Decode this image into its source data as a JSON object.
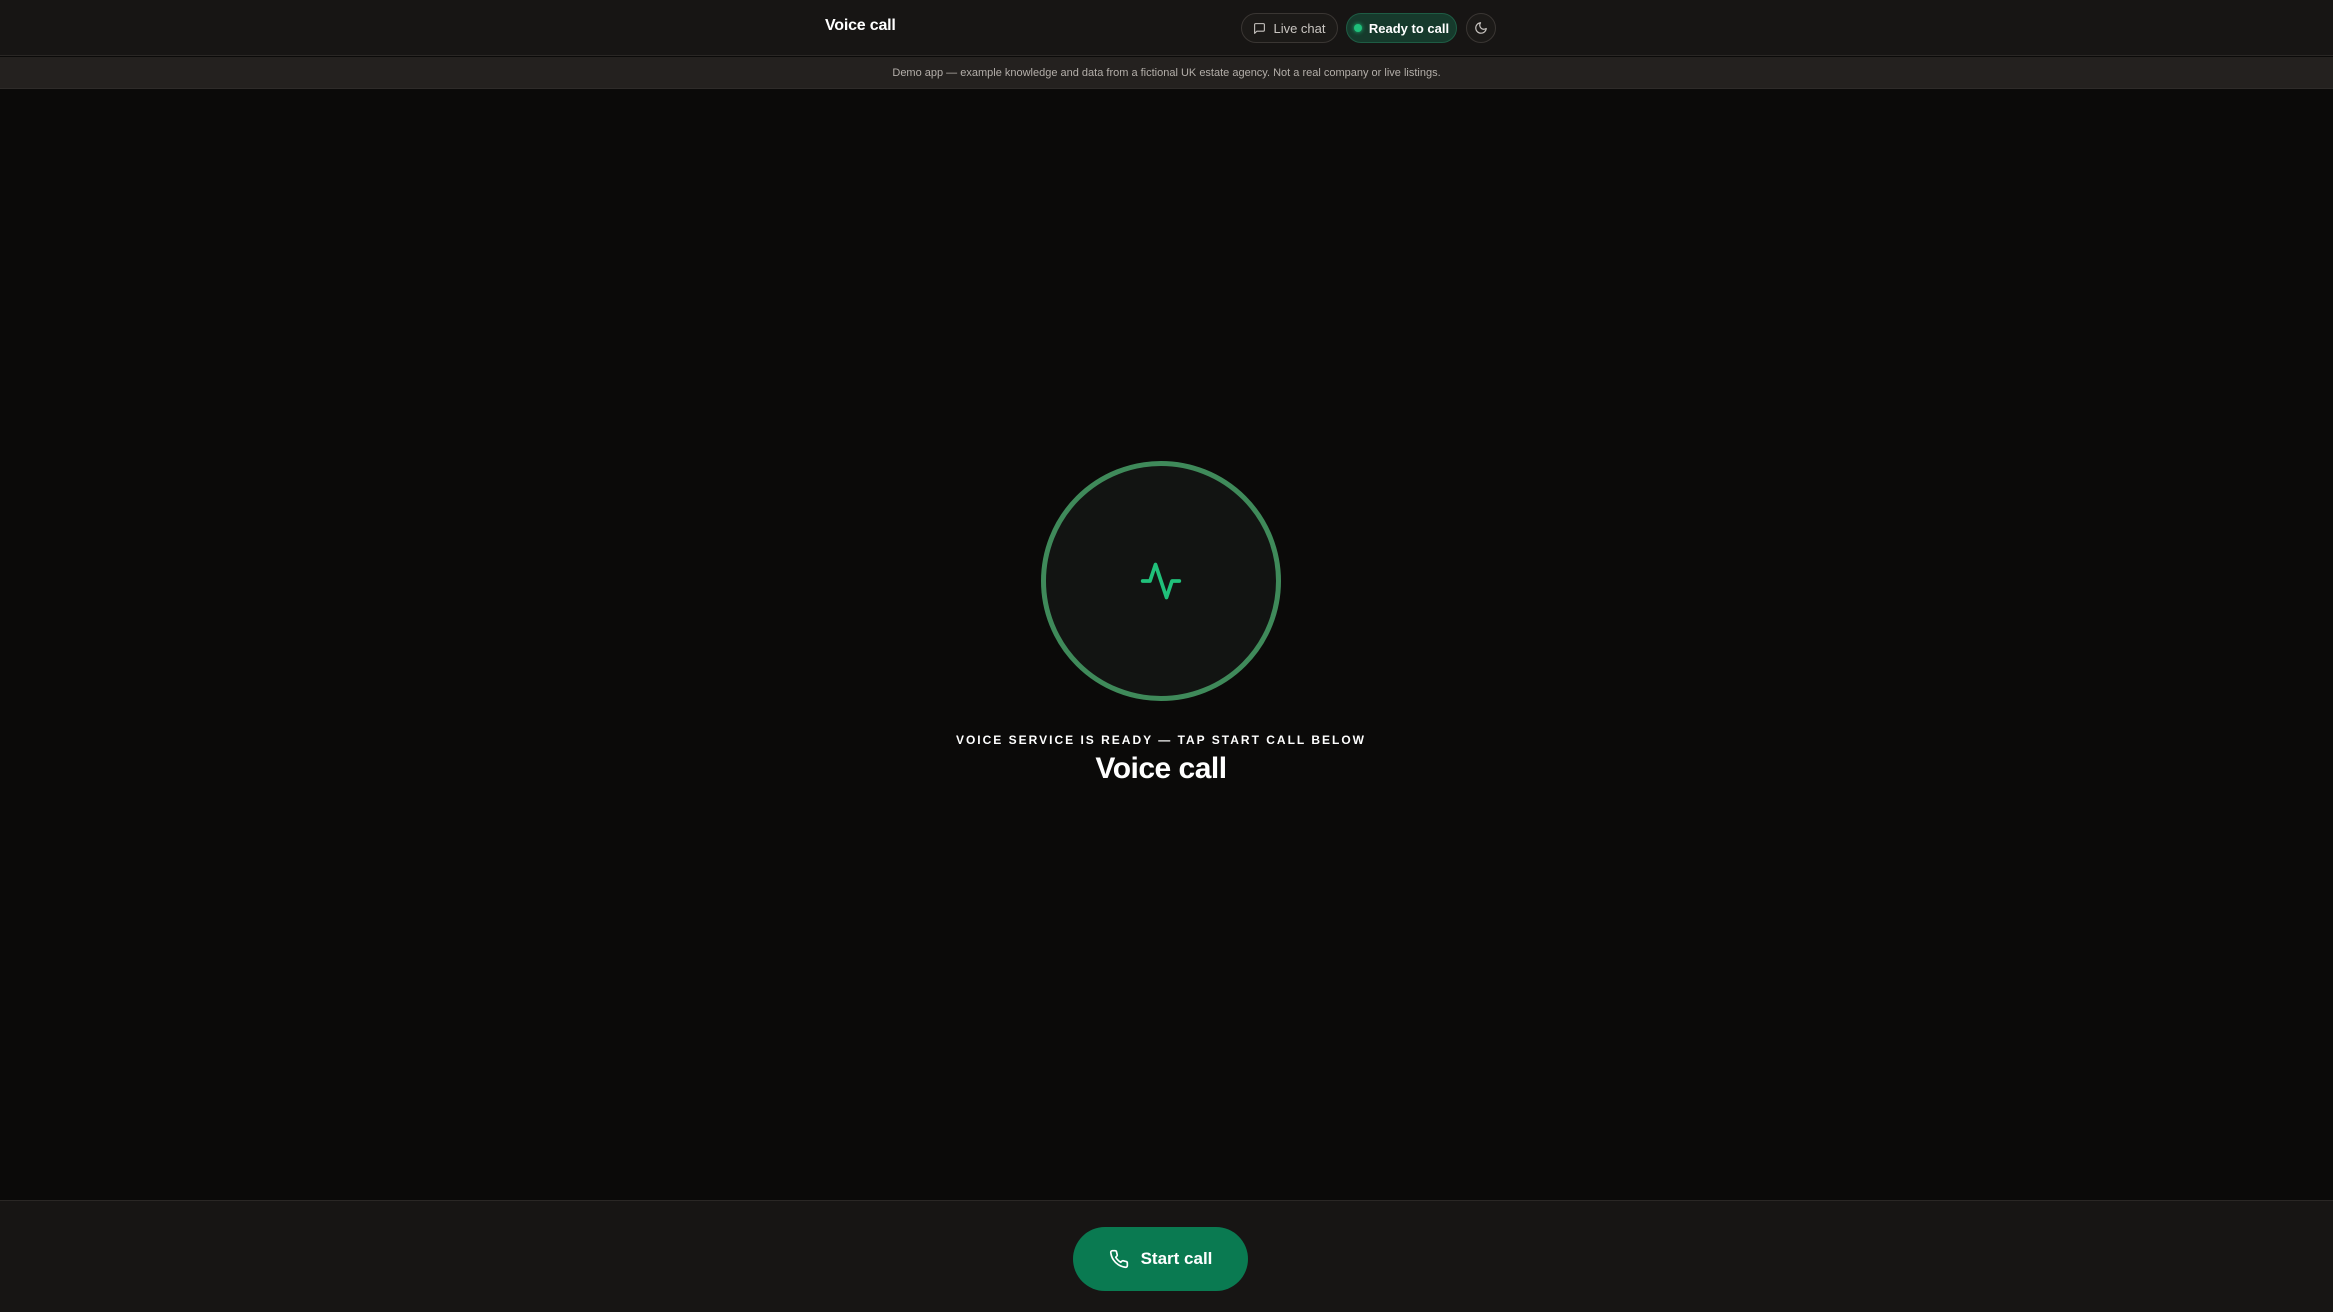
{
  "header": {
    "title": "Voice call",
    "live_chat_label": "Live chat",
    "status_label": "Ready to call",
    "icons": {
      "chat": "message-square-icon",
      "status": "status-dot",
      "theme": "moon-icon"
    }
  },
  "notice": {
    "text": "Demo app — example knowledge and data from a fictional UK estate agency. Not a real company or live listings."
  },
  "main": {
    "status_caption": "VOICE SERVICE IS READY — TAP START CALL BELOW",
    "title": "Voice call",
    "orb_icon": "activity-pulse-icon"
  },
  "footer": {
    "start_label": "Start call",
    "start_icon": "phone-icon"
  },
  "colors": {
    "accent": "#0a7a51",
    "status_green": "#1fbf7a",
    "ring": "#3f8a5a",
    "background": "#0b0a09"
  }
}
